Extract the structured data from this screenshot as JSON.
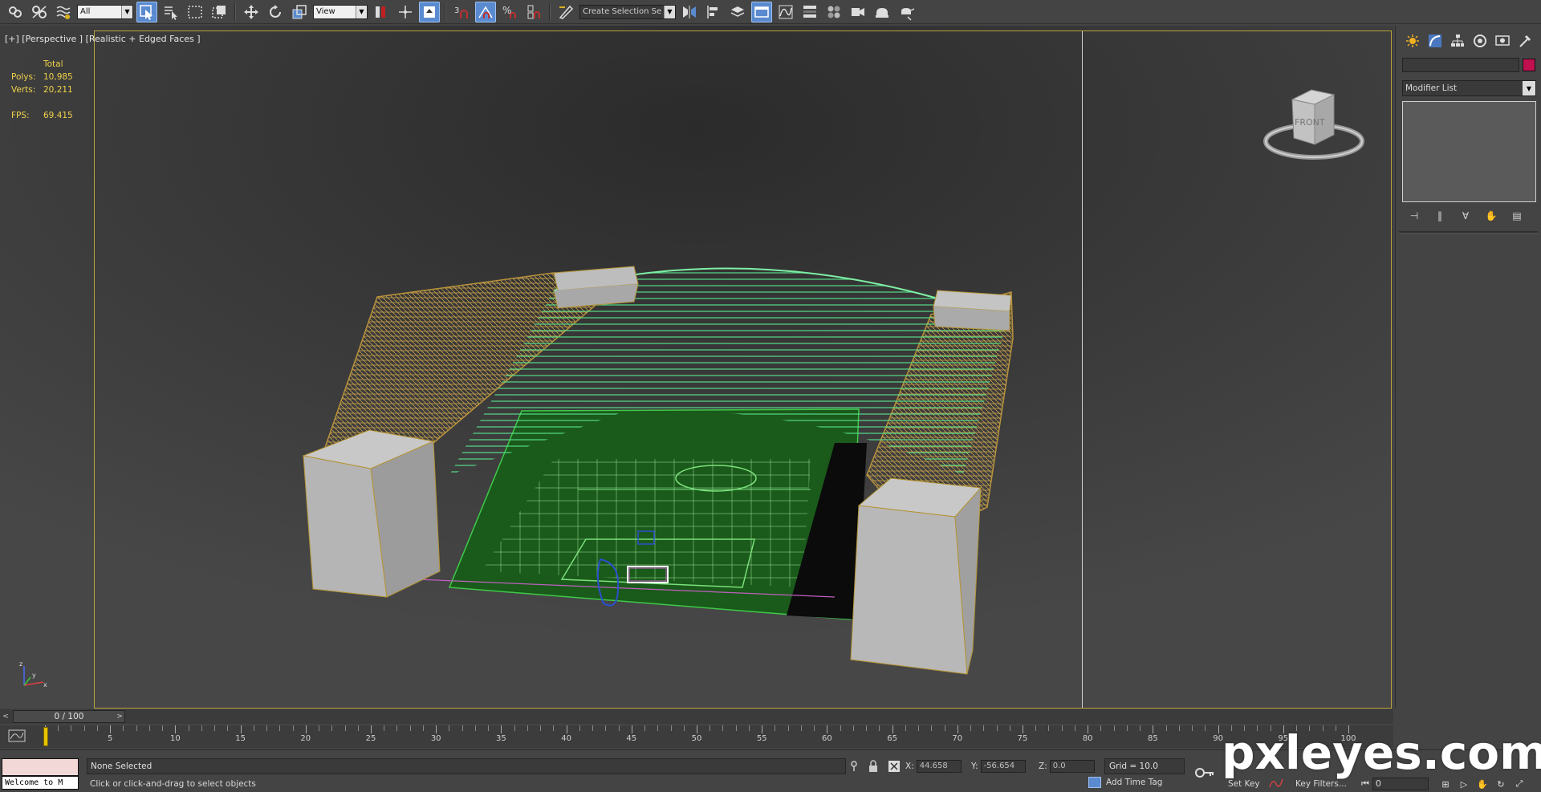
{
  "toolbar": {
    "selection_filter": "All",
    "ref_coord_system": "View",
    "snap_angle_label": "3",
    "percent_snap_label": "%",
    "named_selection_placeholder": "Create Selection Se"
  },
  "viewport": {
    "label": "[+] [Perspective ] [Realistic + Edged Faces ]",
    "stats_header": "Total",
    "polys_label": "Polys:",
    "polys_value": "10,985",
    "verts_label": "Verts:",
    "verts_value": "20,211",
    "fps_label": "FPS:",
    "fps_value": "69.415",
    "viewcube_face": "FRONT",
    "tripod_z": "z",
    "tripod_x": "x",
    "tripod_y": "y"
  },
  "command_panel": {
    "modifier_list": "Modifier List",
    "object_color": "#c0104f"
  },
  "timeline": {
    "frame_display": "0 / 100",
    "prev": "<",
    "next": ">",
    "ticks": [
      "5",
      "10",
      "15",
      "20",
      "25",
      "30",
      "35",
      "40",
      "45",
      "50",
      "55",
      "60",
      "65",
      "70",
      "75",
      "80",
      "85",
      "90",
      "95",
      "100"
    ]
  },
  "status": {
    "maxscript_text": "Welcome to M",
    "selection_status": "None Selected",
    "prompt": "Click or click-and-drag to select objects",
    "x_label": "X:",
    "x_value": "44.658",
    "y_label": "Y:",
    "y_value": "-56.654",
    "z_label": "Z:",
    "z_value": "0.0",
    "grid": "Grid = 10.0",
    "add_time_tag": "Add Time Tag",
    "set_key": "Set Key",
    "key_filters": "Key Filters...",
    "current_frame": "0"
  },
  "watermark": "pxleyes.com",
  "colors": {
    "accent": "#5a8ad0",
    "stats": "#f0d24a",
    "safe_frame": "#b8a33a",
    "timeslider_cursor": "#e6c300"
  },
  "icons": [
    "link-icon",
    "unlink-icon",
    "bind-spacewarp-icon",
    "select-object-icon",
    "select-by-name-icon",
    "rect-region-icon",
    "window-crossing-icon",
    "move-icon",
    "rotate-icon",
    "scale-icon",
    "pivot-icon",
    "manipulate-icon",
    "keyboard-shortcut-icon",
    "snap-icon",
    "angle-snap-icon",
    "percent-snap-icon",
    "spinner-snap-icon",
    "edit-named-selection-icon",
    "mirror-icon",
    "align-icon",
    "layer-icon",
    "graphite-icon",
    "curve-editor-icon",
    "schematic-icon",
    "material-editor-icon",
    "render-setup-icon",
    "rendered-frame-icon",
    "render-icon"
  ]
}
